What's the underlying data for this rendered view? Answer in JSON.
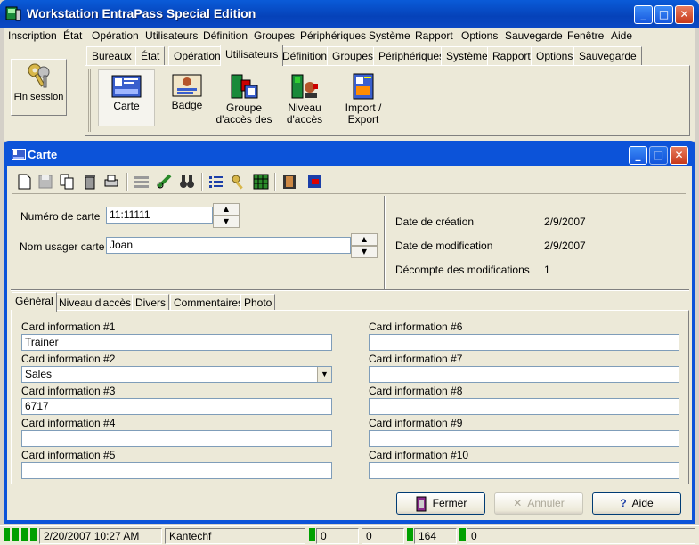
{
  "app": {
    "title": "Workstation EntraPass Special Edition",
    "colors": {
      "title_bar": "#0542b9",
      "face": "#ece9d8",
      "status_led": "#00a000"
    }
  },
  "menu": [
    "Inscription",
    "État",
    "Opération",
    "Utilisateurs",
    "Définition",
    "Groupes",
    "Périphériques",
    "Système",
    "Rapport",
    "Options",
    "Sauvegarde",
    "Fenêtre",
    "Aide"
  ],
  "session": {
    "label": "Fin session",
    "icon": "keys-icon"
  },
  "top_tabs": [
    "Bureaux",
    "État",
    "Opération",
    "Utilisateurs",
    "Définition",
    "Groupes",
    "Périphériques",
    "Système",
    "Rapport",
    "Options",
    "Sauvegarde"
  ],
  "top_tab_active": "Utilisateurs",
  "launchers": [
    {
      "label": "Carte",
      "icon": "card-icon"
    },
    {
      "label": "Badge",
      "icon": "badge-icon"
    },
    {
      "label": "Groupe d'accès des",
      "icon": "access-group-icon"
    },
    {
      "label": "Niveau d'accès",
      "icon": "access-level-icon"
    },
    {
      "label": "Import / Export",
      "icon": "import-export-icon"
    }
  ],
  "window": {
    "title": "Carte",
    "fields": {
      "card_number_label": "Numéro de carte",
      "card_number_value": "11:11111",
      "card_user_label": "Nom usager carte",
      "card_user_value": "Joan"
    },
    "info": {
      "created_label": "Date de création",
      "created_value": "2/9/2007",
      "modified_label": "Date de modification",
      "modified_value": "2/9/2007",
      "count_label": "Décompte des modifications",
      "count_value": "1"
    },
    "tabs": [
      "Général",
      "Niveau d'accès",
      "Divers",
      "Commentaires",
      "Photo"
    ],
    "tab_active": "Général",
    "card_info": [
      {
        "label": "Card information #1",
        "value": "Trainer"
      },
      {
        "label": "Card information #2",
        "value": "Sales"
      },
      {
        "label": "Card information #3",
        "value": "6717"
      },
      {
        "label": "Card information #4",
        "value": ""
      },
      {
        "label": "Card information #5",
        "value": ""
      },
      {
        "label": "Card information #6",
        "value": ""
      },
      {
        "label": "Card information #7",
        "value": ""
      },
      {
        "label": "Card information #8",
        "value": ""
      },
      {
        "label": "Card information #9",
        "value": ""
      },
      {
        "label": "Card information #10",
        "value": ""
      }
    ],
    "buttons": {
      "close": "Fermer",
      "cancel": "Annuler",
      "help": "Aide"
    }
  },
  "status": {
    "datetime": "2/20/2007 10:27 AM",
    "user": "Kantechf",
    "counter1": "0",
    "counter2": "0",
    "counter3": "164",
    "counter4": "0"
  }
}
